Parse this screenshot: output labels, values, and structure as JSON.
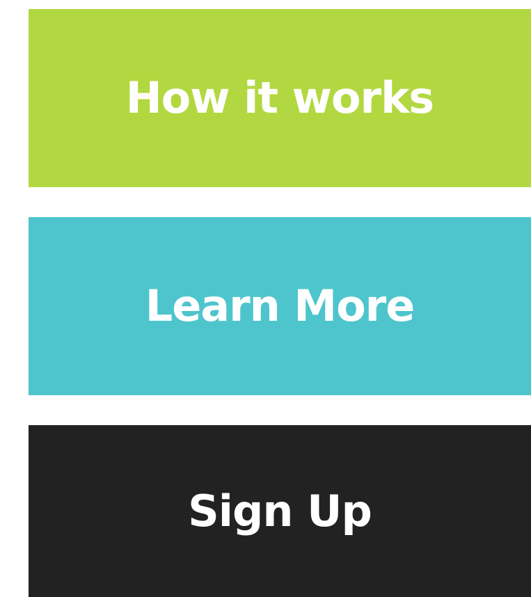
{
  "buttons": {
    "how_it_works": {
      "label": "How it works",
      "color": "#b2d841"
    },
    "learn_more": {
      "label": "Learn More",
      "color": "#4ec5cd"
    },
    "sign_up": {
      "label": "Sign Up",
      "color": "#222222"
    }
  },
  "text_color": "#ffffff"
}
